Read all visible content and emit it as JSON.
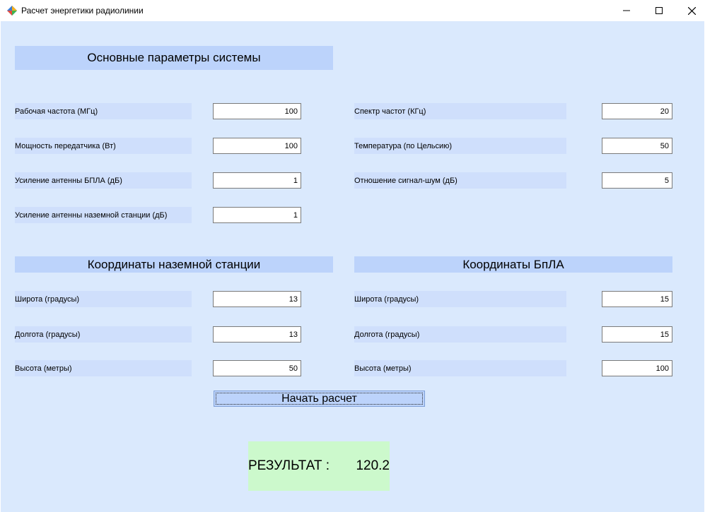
{
  "window": {
    "title": "Расчет энергетики радиолинии",
    "app_icon": "colorful-diamond-icon",
    "controls": [
      "minimize-icon",
      "maximize-icon",
      "close-icon"
    ]
  },
  "sections": {
    "system_params": "Основные параметры системы",
    "ground_coords": "Координаты наземной станции",
    "uav_coords": "Координаты БпЛА"
  },
  "system": {
    "frequency": {
      "label": "Рабочая частота (МГц)",
      "value": "100"
    },
    "tx_power": {
      "label": "Мощность передатчика (Вт)",
      "value": "100"
    },
    "uav_gain": {
      "label": "Усиление антенны БПЛА (дБ)",
      "value": "1"
    },
    "ground_gain": {
      "label": "Усиление антенны наземной станции (дБ)",
      "value": "1"
    },
    "spectrum": {
      "label": "Спектр частот (КГц)",
      "value": "20"
    },
    "temperature": {
      "label": "Температура (по Цельсию)",
      "value": "50"
    },
    "snr": {
      "label": "Отношение сигнал-шум (дБ)",
      "value": "5"
    }
  },
  "ground": {
    "lat": {
      "label": "Широта (градусы)",
      "value": "13"
    },
    "lon": {
      "label": "Долгота (градусы)",
      "value": "13"
    },
    "alt": {
      "label": "Высота (метры)",
      "value": "50"
    }
  },
  "uav": {
    "lat": {
      "label": "Широта (градусы)",
      "value": "15"
    },
    "lon": {
      "label": "Долгота (градусы)",
      "value": "15"
    },
    "alt": {
      "label": "Высота (метры)",
      "value": "100"
    }
  },
  "start_button": "Начать расчет",
  "result": {
    "label": "РЕЗУЛЬТАТ :",
    "value": "120.2"
  },
  "colors": {
    "background": "#dae9fd",
    "header": "#bcd3fb",
    "label_bg": "#cfdffc",
    "result_bg": "#ccf9cc"
  }
}
